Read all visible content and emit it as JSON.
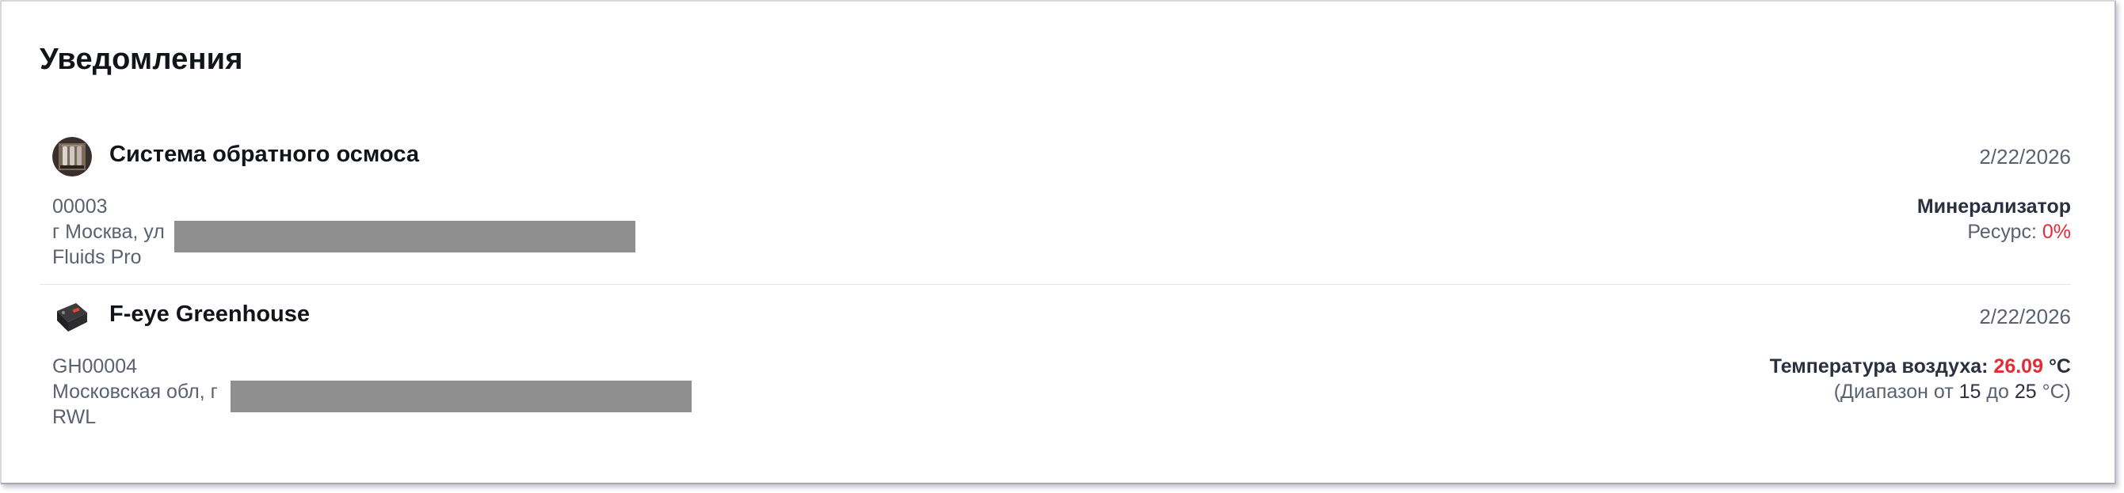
{
  "page": {
    "title": "Уведомления"
  },
  "notifications": [
    {
      "name": "Система обратного осмоса",
      "date": "2/22/2026",
      "avatar_icon": "reverse-osmosis-photo",
      "meta": {
        "id": "00003",
        "address": "г Москва, ул",
        "company": "Fluids Pro"
      },
      "status": {
        "title": "Минерализатор",
        "resource_label": "Ресурс:",
        "resource_value": "0%"
      }
    },
    {
      "name": "F-eye Greenhouse",
      "date": "2/22/2026",
      "avatar_icon": "sensor-device-photo",
      "meta": {
        "id": "GH00004",
        "address": "Московская обл, г",
        "company": "RWL"
      },
      "status": {
        "label": "Температура воздуха:",
        "value": "26.09",
        "unit": "°C",
        "range_prefix": "(Диапазон от",
        "range_min": "15",
        "range_mid": "до",
        "range_max": "25",
        "range_suffix": "°C)"
      }
    }
  ],
  "colors": {
    "danger": "#e52b35",
    "muted": "#5b6170",
    "heading": "#111418",
    "redaction": "#8f8f8f"
  }
}
